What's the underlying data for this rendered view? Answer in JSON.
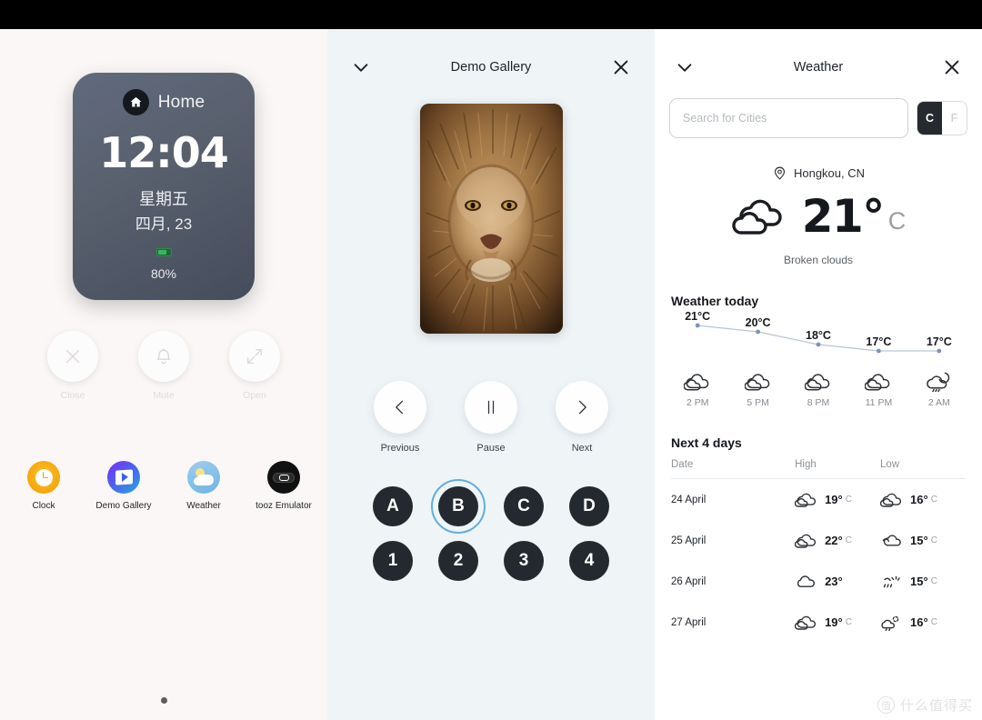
{
  "left_panel": {
    "watch": {
      "home_label": "Home",
      "time": "12:04",
      "weekday": "星期五",
      "date": "四月, 23",
      "battery_pct": "80%",
      "home_icon": "home-icon",
      "battery_icon": "battery-icon"
    },
    "controls": [
      {
        "label": "Close",
        "icon": "close-icon"
      },
      {
        "label": "Mute",
        "icon": "bell-icon"
      },
      {
        "label": "Open",
        "icon": "expand-arrows-icon"
      }
    ],
    "apps": [
      {
        "label": "Clock",
        "icon": "clock-app-icon"
      },
      {
        "label": "Demo Gallery",
        "icon": "gallery-app-icon"
      },
      {
        "label": "Weather",
        "icon": "weather-app-icon"
      },
      {
        "label": "tooz Emulator",
        "icon": "tooz-app-icon"
      }
    ],
    "page_indicator": "page-dot"
  },
  "mid_panel": {
    "title": "Demo Gallery",
    "collapse_icon": "chevron-down-icon",
    "close_icon": "close-icon",
    "photo_alt": "lion-photo",
    "media_controls": [
      {
        "label": "Previous",
        "icon": "chevron-left-icon"
      },
      {
        "label": "Pause",
        "icon": "pause-icon"
      },
      {
        "label": "Next",
        "icon": "chevron-right-icon"
      }
    ],
    "letter_buttons": [
      "A",
      "B",
      "C",
      "D"
    ],
    "number_buttons": [
      "1",
      "2",
      "3",
      "4"
    ],
    "selected_button": "B",
    "selection_color": "#62aee0"
  },
  "right_panel": {
    "title": "Weather",
    "collapse_icon": "chevron-down-icon",
    "close_icon": "close-icon",
    "search": {
      "placeholder": "Search for Cities",
      "value": ""
    },
    "units": {
      "celsius": "C",
      "fahrenheit": "F",
      "active": "C"
    },
    "location": "Hongkou, CN",
    "location_icon": "location-pin-icon",
    "current_temp": "21°",
    "current_unit": "C",
    "current_icon": "broken-clouds-icon",
    "condition": "Broken clouds",
    "today_title": "Weather today",
    "forecast_title": "Next 4 days",
    "table_headers": {
      "date": "Date",
      "high": "High",
      "low": "Low"
    },
    "forecast_rows": [
      {
        "date": "24 April",
        "high": "19°",
        "high_unit": "C",
        "high_icon": "cloud-icon",
        "low": "16°",
        "low_unit": "C",
        "low_icon": "cloud-icon"
      },
      {
        "date": "25 April",
        "high": "22°",
        "high_unit": "C",
        "high_icon": "cloud-icon",
        "low": "15°",
        "low_unit": "C",
        "low_icon": "broken-clouds-icon"
      },
      {
        "date": "26 April",
        "high": "23°",
        "high_unit": "",
        "high_icon": "cloud-icon",
        "low": "15°",
        "low_unit": "C",
        "low_icon": "rain-sun-icon"
      },
      {
        "date": "27 April",
        "high": "19°",
        "high_unit": "C",
        "high_icon": "cloud-icon",
        "low": "16°",
        "low_unit": "C",
        "low_icon": "rain-sun-icon"
      }
    ]
  },
  "chart_data": {
    "type": "line",
    "title": "Weather today",
    "x": [
      "2 PM",
      "5 PM",
      "8 PM",
      "11 PM",
      "2 AM"
    ],
    "values": [
      21,
      20,
      18,
      17,
      17
    ],
    "labels": [
      "21°C",
      "20°C",
      "18°C",
      "17°C",
      "17°C"
    ],
    "icons": [
      "cloud-icon",
      "cloud-icon",
      "cloud-icon",
      "cloud-icon",
      "moon-rain-icon"
    ],
    "unit": "°C",
    "line_color": "#b9c6d4",
    "point_color": "#7c93ba",
    "ylim": [
      16,
      22
    ],
    "grid": false,
    "legend": false
  },
  "watermark": {
    "logo": "值",
    "text": "什么值得买"
  }
}
